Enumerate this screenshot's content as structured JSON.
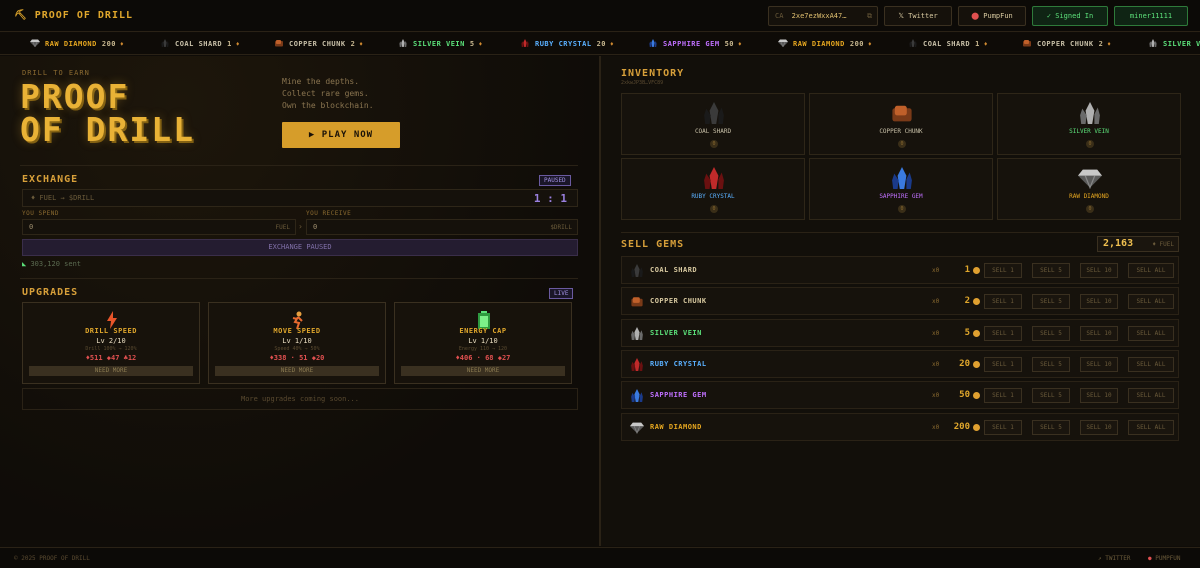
{
  "header": {
    "logo": "⛏ PROOF OF DRILL",
    "ca_label": "CA",
    "ca_value": "2xe7ezWxxA47…",
    "twitter": "𝕏 Twitter",
    "pumpfun": "PumpFun",
    "signed_in": "✓ Signed In",
    "username": "miner11111"
  },
  "ticker": [
    {
      "name": "RAW DIAMOND",
      "value": "200",
      "color": "#e6a720"
    },
    {
      "name": "COAL SHARD",
      "value": "1",
      "color": "#c8c0a8"
    },
    {
      "name": "COPPER CHUNK",
      "value": "2",
      "color": "#c8c0a8"
    },
    {
      "name": "SILVER VEIN",
      "value": "5",
      "color": "#5ce07a"
    },
    {
      "name": "RUBY CRYSTAL",
      "value": "20",
      "color": "#5ab0ff"
    },
    {
      "name": "SAPPHIRE GEM",
      "value": "50",
      "color": "#c070ff"
    },
    {
      "name": "RAW DIAMOND",
      "value": "200",
      "color": "#e6a720"
    },
    {
      "name": "COAL SHARD",
      "value": "1",
      "color": "#c8c0a8"
    },
    {
      "name": "COPPER CHUNK",
      "value": "2",
      "color": "#c8c0a8"
    },
    {
      "name": "SILVER VEIN",
      "value": "",
      "color": "#5ce07a"
    }
  ],
  "hero": {
    "label": "DRILL TO EARN",
    "title_line1": "PROOF",
    "title_line2": "OF DRILL",
    "tag1": "Mine the depths.",
    "tag2": "Collect rare gems.",
    "tag3": "Own the blockchain.",
    "play": "▶ PLAY NOW"
  },
  "exchange": {
    "title": "EXCHANGE",
    "status": "PAUSED",
    "pair": "♦ FUEL → $DRILL",
    "rate": "1 : 1",
    "spend_label": "YOU SPEND",
    "receive_label": "YOU RECEIVE",
    "spend_value": "0",
    "spend_unit": "FUEL",
    "receive_value": "0",
    "receive_unit": "$DRILL",
    "swap_icon": "›",
    "paused_button": "EXCHANGE PAUSED",
    "sent": "303,120 sent"
  },
  "upgrades": {
    "title": "UPGRADES",
    "status": "LIVE",
    "items": [
      {
        "name": "DRILL SPEED",
        "level": "Lv 2/10",
        "desc": "Drill 100% → 120%",
        "cost": "♦511  ◆47  ♣12"
      },
      {
        "name": "MOVE SPEED",
        "level": "Lv 1/10",
        "desc": "Speed 40% → 50%",
        "cost": "♦338 · 51  ◆20"
      },
      {
        "name": "ENERGY CAP",
        "level": "Lv 1/10",
        "desc": "Energy 110 → 120",
        "cost": "♦406 · 68  ◆27"
      }
    ],
    "need_more": "NEED MORE",
    "coming_soon": "More upgrades coming soon..."
  },
  "inventory": {
    "title": "INVENTORY",
    "address": "2xkwJP3B…VFC89",
    "items": [
      {
        "name": "COAL SHARD",
        "count": "0",
        "color": "#c8c0a8"
      },
      {
        "name": "COPPER CHUNK",
        "count": "0",
        "color": "#c8c0a8"
      },
      {
        "name": "SILVER VEIN",
        "count": "0",
        "color": "#5ce07a"
      },
      {
        "name": "RUBY CRYSTAL",
        "count": "0",
        "color": "#5ab0ff"
      },
      {
        "name": "SAPPHIRE GEM",
        "count": "0",
        "color": "#c070ff"
      },
      {
        "name": "RAW DIAMOND",
        "count": "0",
        "color": "#e6a720"
      }
    ]
  },
  "sell": {
    "title": "SELL GEMS",
    "balance": "2,163",
    "balance_unit": "♦ FUEL",
    "buttons": [
      "SELL 1",
      "SELL 5",
      "SELL 10",
      "SELL ALL"
    ],
    "rows": [
      {
        "name": "COAL SHARD",
        "qty": "x0",
        "price": "1",
        "color": "#d8c9a0"
      },
      {
        "name": "COPPER CHUNK",
        "qty": "x0",
        "price": "2",
        "color": "#d8c9a0"
      },
      {
        "name": "SILVER VEIN",
        "qty": "x0",
        "price": "5",
        "color": "#5ce07a"
      },
      {
        "name": "RUBY CRYSTAL",
        "qty": "x0",
        "price": "20",
        "color": "#5ab0ff"
      },
      {
        "name": "SAPPHIRE GEM",
        "qty": "x0",
        "price": "50",
        "color": "#c070ff"
      },
      {
        "name": "RAW DIAMOND",
        "qty": "x0",
        "price": "200",
        "color": "#e6a720"
      }
    ]
  },
  "footer": {
    "copyright": "© 2025 PROOF OF DRILL",
    "twitter": "↗ TWITTER",
    "pumpfun": "PUMPFUN"
  }
}
